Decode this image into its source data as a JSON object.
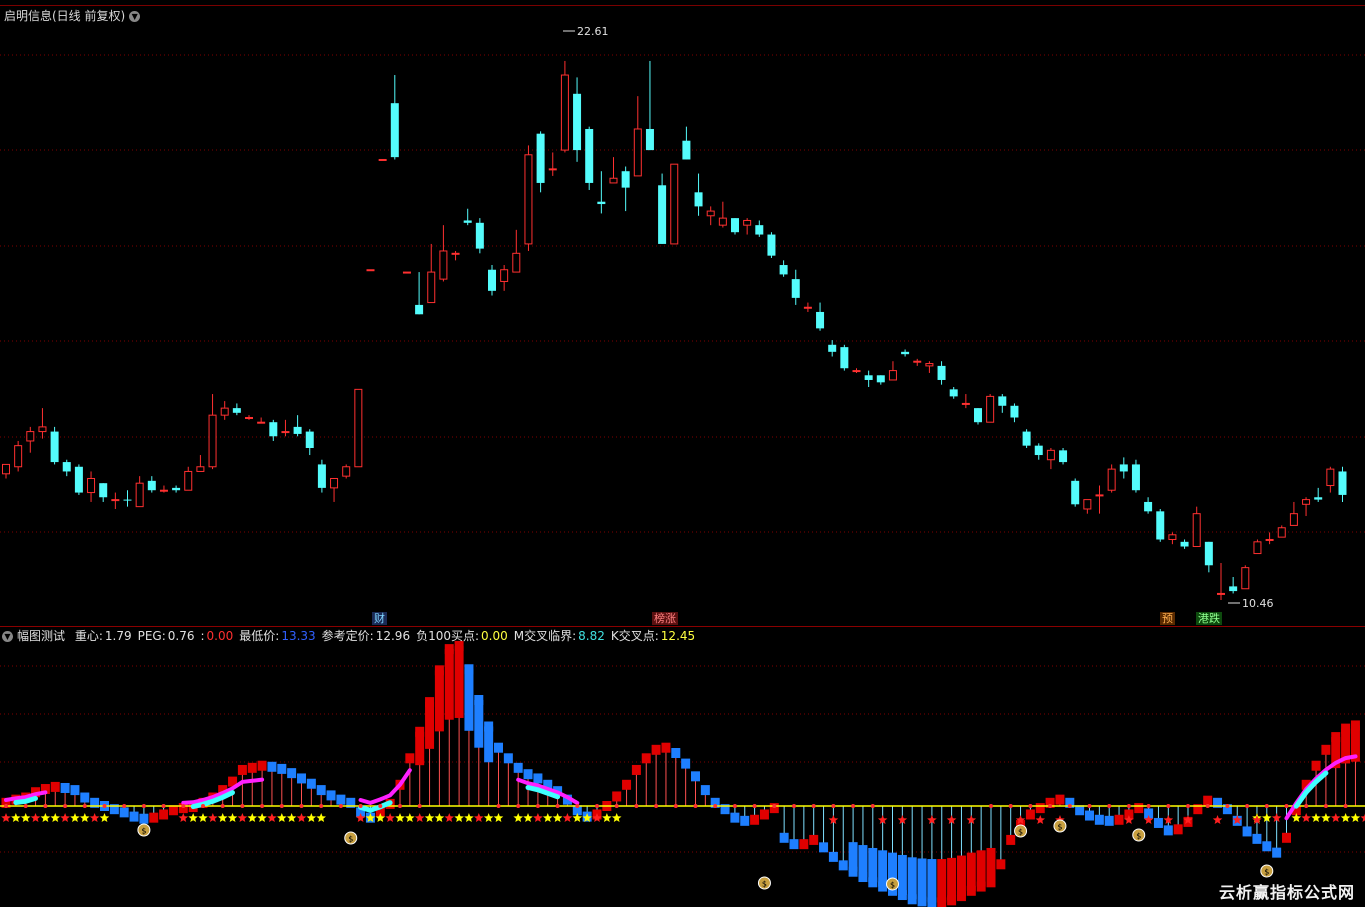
{
  "header": {
    "title": "启明信息(日线 前复权)",
    "high_label": "22.61",
    "low_label": "10.46"
  },
  "badges": [
    {
      "text": "财",
      "color": "#7fd4ff",
      "bg": "#1a2a55"
    },
    {
      "text": "榜涨",
      "color": "#ff8080",
      "bg": "#5a1010"
    },
    {
      "text": "预",
      "color": "#ffb050",
      "bg": "#5a2a00"
    },
    {
      "text": "港跌",
      "color": "#90ff90",
      "bg": "#0d4a0d"
    }
  ],
  "indicator": {
    "title": "幅图测试",
    "fields": [
      {
        "label": "重心:",
        "value": "1.79",
        "color": "#e0e0e0"
      },
      {
        "label": "PEG:",
        "value": "0.76",
        "color": "#e0e0e0"
      },
      {
        "label": ":",
        "value": "0.00",
        "color": "#ff3030"
      },
      {
        "label": "最低价:",
        "value": "13.33",
        "color": "#3060ff"
      },
      {
        "label": "参考定价:",
        "value": "12.96",
        "color": "#e0e0e0"
      },
      {
        "label": "负100买点:",
        "value": "0.00",
        "color": "#ffff40"
      },
      {
        "label": "M交叉临界:",
        "value": "8.82",
        "color": "#40e0e0"
      },
      {
        "label": "K交叉点:",
        "value": "12.45",
        "color": "#ffff40"
      }
    ]
  },
  "colors": {
    "up": "#ff3030",
    "down": "#54fcfc",
    "grid": "#800000",
    "hist_red": "#e00000",
    "hist_blue": "#1e7fff",
    "curve_magenta": "#ff20ff",
    "curve_cyan": "#40ffff",
    "zero_line": "#ffff00",
    "star_yellow": "#ffff00",
    "star_red": "#ff2020"
  },
  "icons": [
    "chevron-down-icon",
    "money-bag-icon",
    "star-icon"
  ],
  "watermark": "云析赢指标公式网",
  "chart_data": [
    {
      "type": "candlestick",
      "y_extent": [
        10.46,
        22.61
      ],
      "candles": [
        [
          13.15,
          13.35,
          13.35,
          13.05
        ],
        [
          13.3,
          13.75,
          13.85,
          13.2
        ],
        [
          13.85,
          14.05,
          14.15,
          13.6
        ],
        [
          14.05,
          14.15,
          14.55,
          13.9
        ],
        [
          14.05,
          13.4,
          14.15,
          13.35
        ],
        [
          13.4,
          13.2,
          13.45,
          13.1
        ],
        [
          13.3,
          12.75,
          13.35,
          12.7
        ],
        [
          12.75,
          13.05,
          13.2,
          12.55
        ],
        [
          12.95,
          12.65,
          12.95,
          12.55
        ],
        [
          12.6,
          12.6,
          12.75,
          12.4
        ],
        [
          12.6,
          12.58,
          12.8,
          12.45
        ],
        [
          12.45,
          12.95,
          13.1,
          12.45
        ],
        [
          13.0,
          12.8,
          13.1,
          12.75
        ],
        [
          12.8,
          12.8,
          12.9,
          12.75
        ],
        [
          12.85,
          12.8,
          12.9,
          12.75
        ],
        [
          12.8,
          13.2,
          13.3,
          12.8
        ],
        [
          13.2,
          13.3,
          13.55,
          13.2
        ],
        [
          13.3,
          14.4,
          14.85,
          13.25
        ],
        [
          14.4,
          14.55,
          14.7,
          14.3
        ],
        [
          14.55,
          14.45,
          14.65,
          14.4
        ],
        [
          14.35,
          14.35,
          14.4,
          14.3
        ],
        [
          14.25,
          14.25,
          14.35,
          14.25
        ],
        [
          14.25,
          13.95,
          14.3,
          13.85
        ],
        [
          14.05,
          14.05,
          14.3,
          13.95
        ],
        [
          14.15,
          14.0,
          14.4,
          13.95
        ],
        [
          14.05,
          13.7,
          14.1,
          13.55
        ],
        [
          13.35,
          12.85,
          13.45,
          12.75
        ],
        [
          12.85,
          13.05,
          13.05,
          12.55
        ],
        [
          13.1,
          13.3,
          13.35,
          13.05
        ],
        [
          13.3,
          14.95,
          14.95,
          13.3
        ],
        [
          17.5,
          17.5,
          17.5,
          17.5
        ],
        [
          19.85,
          19.85,
          19.85,
          19.85
        ],
        [
          21.05,
          19.9,
          21.65,
          19.85
        ],
        [
          17.45,
          17.45,
          17.45,
          17.45
        ],
        [
          16.75,
          16.55,
          17.45,
          16.55
        ],
        [
          16.8,
          17.45,
          18.05,
          16.8
        ],
        [
          17.3,
          17.9,
          18.45,
          17.25
        ],
        [
          17.85,
          17.85,
          17.9,
          17.7
        ],
        [
          18.55,
          18.5,
          18.8,
          18.45
        ],
        [
          18.5,
          17.95,
          18.6,
          17.85
        ],
        [
          17.5,
          17.05,
          17.6,
          16.95
        ],
        [
          17.25,
          17.5,
          17.6,
          17.05
        ],
        [
          17.45,
          17.85,
          18.35,
          17.45
        ],
        [
          18.05,
          19.95,
          20.15,
          17.9
        ],
        [
          20.4,
          19.35,
          20.45,
          19.15
        ],
        [
          19.65,
          19.65,
          20.0,
          19.5
        ],
        [
          20.05,
          21.65,
          21.95,
          20.0
        ],
        [
          21.25,
          20.05,
          21.6,
          19.8
        ],
        [
          20.5,
          19.35,
          20.55,
          19.2
        ],
        [
          18.95,
          18.9,
          19.6,
          18.7
        ],
        [
          19.35,
          19.45,
          19.9,
          19.35
        ],
        [
          19.6,
          19.25,
          19.7,
          18.75
        ],
        [
          19.5,
          20.5,
          21.2,
          19.5
        ],
        [
          20.5,
          20.05,
          21.95,
          20.05
        ],
        [
          19.3,
          18.05,
          19.55,
          18.05
        ],
        [
          18.05,
          19.75,
          19.75,
          18.05
        ],
        [
          20.25,
          19.85,
          20.55,
          19.85
        ],
        [
          19.15,
          18.85,
          19.55,
          18.65
        ],
        [
          18.65,
          18.75,
          18.85,
          18.45
        ],
        [
          18.45,
          18.6,
          18.95,
          18.4
        ],
        [
          18.6,
          18.3,
          18.6,
          18.25
        ],
        [
          18.45,
          18.55,
          18.6,
          18.25
        ],
        [
          18.45,
          18.25,
          18.55,
          18.2
        ],
        [
          18.25,
          17.8,
          18.3,
          17.75
        ],
        [
          17.6,
          17.4,
          17.7,
          17.35
        ],
        [
          17.3,
          16.9,
          17.5,
          16.75
        ],
        [
          16.7,
          16.7,
          16.8,
          16.6
        ],
        [
          16.6,
          16.25,
          16.8,
          16.2
        ],
        [
          15.9,
          15.75,
          16.0,
          15.65
        ],
        [
          15.85,
          15.4,
          15.9,
          15.35
        ],
        [
          15.35,
          15.35,
          15.4,
          15.3
        ],
        [
          15.25,
          15.15,
          15.35,
          15.0
        ],
        [
          15.25,
          15.1,
          15.25,
          15.05
        ],
        [
          15.15,
          15.35,
          15.55,
          15.15
        ],
        [
          15.75,
          15.7,
          15.8,
          15.65
        ],
        [
          15.55,
          15.55,
          15.6,
          15.45
        ],
        [
          15.45,
          15.5,
          15.55,
          15.3
        ],
        [
          15.45,
          15.15,
          15.55,
          15.05
        ],
        [
          14.95,
          14.8,
          15.0,
          14.75
        ],
        [
          14.65,
          14.65,
          14.85,
          14.55
        ],
        [
          14.55,
          14.25,
          14.55,
          14.2
        ],
        [
          14.25,
          14.8,
          14.85,
          14.25
        ],
        [
          14.8,
          14.6,
          14.85,
          14.45
        ],
        [
          14.6,
          14.35,
          14.65,
          14.25
        ],
        [
          14.05,
          13.75,
          14.1,
          13.7
        ],
        [
          13.75,
          13.55,
          13.8,
          13.45
        ],
        [
          13.45,
          13.65,
          13.7,
          13.25
        ],
        [
          13.65,
          13.4,
          13.7,
          13.35
        ],
        [
          13.0,
          12.5,
          13.05,
          12.45
        ],
        [
          12.4,
          12.6,
          12.6,
          12.3
        ],
        [
          12.7,
          12.7,
          12.9,
          12.3
        ],
        [
          12.8,
          13.25,
          13.35,
          12.75
        ],
        [
          13.35,
          13.2,
          13.5,
          13.05
        ],
        [
          13.35,
          12.8,
          13.45,
          12.75
        ],
        [
          12.55,
          12.35,
          12.65,
          12.3
        ],
        [
          12.35,
          11.75,
          12.4,
          11.7
        ],
        [
          11.75,
          11.85,
          11.9,
          11.65
        ],
        [
          11.7,
          11.6,
          11.75,
          11.55
        ],
        [
          11.6,
          12.3,
          12.45,
          11.6
        ],
        [
          11.7,
          11.2,
          11.7,
          11.05
        ],
        [
          10.6,
          10.6,
          11.25,
          10.46
        ],
        [
          10.75,
          10.65,
          10.95,
          10.6
        ],
        [
          10.7,
          11.15,
          11.2,
          10.7
        ],
        [
          11.45,
          11.7,
          11.75,
          11.45
        ],
        [
          11.75,
          11.75,
          11.9,
          11.65
        ],
        [
          11.8,
          12.0,
          12.05,
          11.85
        ],
        [
          12.05,
          12.3,
          12.55,
          12.05
        ],
        [
          12.5,
          12.6,
          12.65,
          12.25
        ],
        [
          12.65,
          12.6,
          12.85,
          12.55
        ],
        [
          12.9,
          13.25,
          13.3,
          12.75
        ],
        [
          13.2,
          12.7,
          13.3,
          12.55
        ]
      ]
    },
    {
      "type": "bar",
      "zero": 0,
      "hist": [
        {
          "from": 0,
          "to": 26,
          "red": [
            3,
            4,
            5,
            6,
            7
          ],
          "blue": [
            0,
            2,
            4,
            5,
            6,
            7,
            8,
            9,
            10,
            11,
            12,
            13,
            14,
            15,
            16,
            17,
            18,
            19,
            20,
            21,
            22,
            23,
            24,
            25
          ]
        }
      ],
      "values": [
        0.3,
        0.6,
        0.8,
        1.3,
        1.6,
        1.8,
        1.7,
        1.5,
        0.8,
        0.3,
        0.0,
        -0.3,
        -0.6,
        -1.0,
        -1.2,
        -1.1,
        -0.8,
        -0.4,
        -0.2,
        -0.1,
        0.3,
        0.8,
        1.5,
        2.3,
        3.4,
        3.6,
        3.8,
        3.7,
        3.5,
        3.1,
        2.6,
        2.1,
        1.5,
        1.0,
        0.6,
        0.3,
        -0.6,
        -1.1,
        -0.5,
        0.2,
        2.0,
        4.5,
        7.0,
        9.8,
        12.8,
        14.8,
        15.1,
        12.9,
        10.0,
        7.5,
        5.5,
        4.5,
        3.6,
        3.0,
        2.6,
        2.0,
        1.4,
        0.6,
        -0.4,
        -1.0,
        -0.8,
        0.0,
        0.9,
        2.0,
        3.4,
        4.5,
        5.3,
        5.5,
        5.0,
        4.0,
        2.8,
        1.5,
        0.3,
        -0.3,
        -1.1,
        -1.4,
        -1.3,
        -0.8,
        -0.2,
        -3.0,
        -3.6,
        -3.6,
        -3.2,
        -3.9,
        -4.8,
        -5.6,
        -6.2,
        -6.7,
        -7.2,
        -7.6,
        -8.0,
        -8.4,
        -8.8,
        -9.0,
        -9.1,
        -9.1,
        -8.9,
        -8.5,
        -8.0,
        -7.6,
        -7.2,
        -5.5,
        -3.2,
        -1.8,
        -0.8,
        -0.2,
        0.3,
        0.6,
        0.3,
        -0.4,
        -0.9,
        -1.3,
        -1.4,
        -1.3,
        -0.8,
        -0.2,
        -0.7,
        -1.6,
        -2.3,
        -2.2,
        -1.5,
        -0.3,
        0.5,
        0.3,
        -0.3,
        -1.4,
        -2.4,
        -3.1,
        -3.8,
        -4.4,
        -3.0,
        -0.4,
        2.0,
        3.8,
        5.3,
        6.5,
        7.3,
        7.6
      ]
    }
  ]
}
